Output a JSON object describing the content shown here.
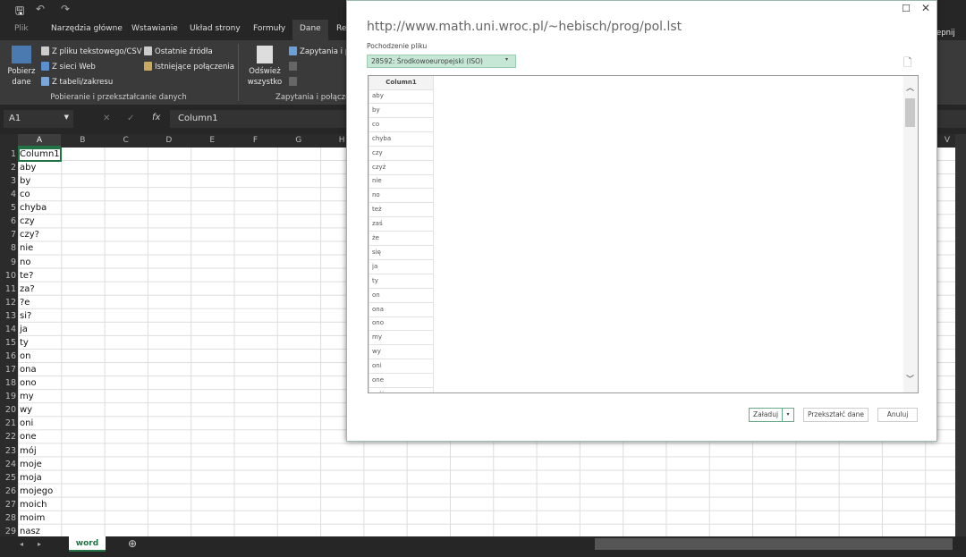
{
  "quick_access": {
    "save_icon": "save-icon",
    "undo_icon": "undo-icon",
    "redo_icon": "redo-icon"
  },
  "ribbon_tabs": [
    "Plik",
    "Narzędzia główne",
    "Wstawianie",
    "Układ strony",
    "Formuły",
    "Dane",
    "Re"
  ],
  "active_tab": "Dane",
  "ribbon": {
    "get_data": "Pobierz dane",
    "from_text": "Z pliku tekstowego/CSV",
    "from_web": "Z sieci Web",
    "from_table": "Z tabeli/zakresu",
    "recent_sources": "Ostatnie źródła",
    "existing_connections": "Istniejące połączenia",
    "group1": "Pobieranie i przekształcanie danych",
    "refresh_all": "Odśwież wszystko",
    "queries": "Zapytania i p",
    "group2": "Zapytania i połączen",
    "ungroup": "epnij"
  },
  "formula_bar": {
    "name_box": "A1",
    "value": "Column1",
    "fx": "fx"
  },
  "columns": [
    "A",
    "B",
    "C",
    "D",
    "E",
    "F",
    "G",
    "H"
  ],
  "right_col": "V",
  "cells": [
    "Column1",
    "aby",
    "by",
    "co",
    "chyba",
    "czy",
    "czy?",
    "nie",
    "no",
    "te?",
    "za?",
    "?e",
    "si?",
    "ja",
    "ty",
    "on",
    "ona",
    "ono",
    "my",
    "wy",
    "oni",
    "one",
    "mój",
    "moje",
    "moja",
    "mojego",
    "moich",
    "moim",
    "nasz"
  ],
  "sheet_tab": "word",
  "dialog": {
    "title": "http://www.math.uni.wroc.pl/~hebisch/prog/pol.lst",
    "origin_label": "Pochodzenie pliku",
    "origin_value": "28592: Środkowoeuropejski (ISO)",
    "preview_header": "Column1",
    "preview_rows": [
      "aby",
      "by",
      "co",
      "chyba",
      "czy",
      "czyż",
      "nie",
      "no",
      "też",
      "zaś",
      "że",
      "się",
      "ja",
      "ty",
      "on",
      "ona",
      "ono",
      "my",
      "wy",
      "oni",
      "one",
      "mój"
    ],
    "load": "Załaduj",
    "transform": "Przekształć dane",
    "cancel": "Anuluj"
  }
}
